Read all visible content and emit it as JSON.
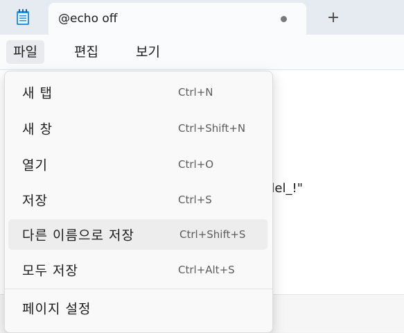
{
  "tab": {
    "title": "@echo off",
    "new_tab": "+"
  },
  "menubar": {
    "file": "파일",
    "edit": "편집",
    "view": "보기"
  },
  "editor": {
    "visible_fragment": "del_!\""
  },
  "file_menu": {
    "items": [
      {
        "label": "새 탭",
        "shortcut": "Ctrl+N"
      },
      {
        "label": "새 창",
        "shortcut": "Ctrl+Shift+N"
      },
      {
        "label": "열기",
        "shortcut": "Ctrl+O"
      },
      {
        "label": "저장",
        "shortcut": "Ctrl+S"
      },
      {
        "label": "다른 이름으로 저장",
        "shortcut": "Ctrl+Shift+S"
      },
      {
        "label": "모두 저장",
        "shortcut": "Ctrl+Alt+S"
      },
      {
        "label": "페이지 설정",
        "shortcut": ""
      }
    ],
    "highlighted_index": 4
  },
  "colors": {
    "tabstrip": "#e6ebf1",
    "active_tab": "#fafbfd",
    "menu_bg": "#f9f9f9",
    "highlight": "#ededed",
    "notepad_icon": "#2f8fd6"
  },
  "icons": {
    "app": "notepad-icon",
    "unsaved": "unsaved-dot-icon",
    "new_tab": "plus-icon"
  }
}
